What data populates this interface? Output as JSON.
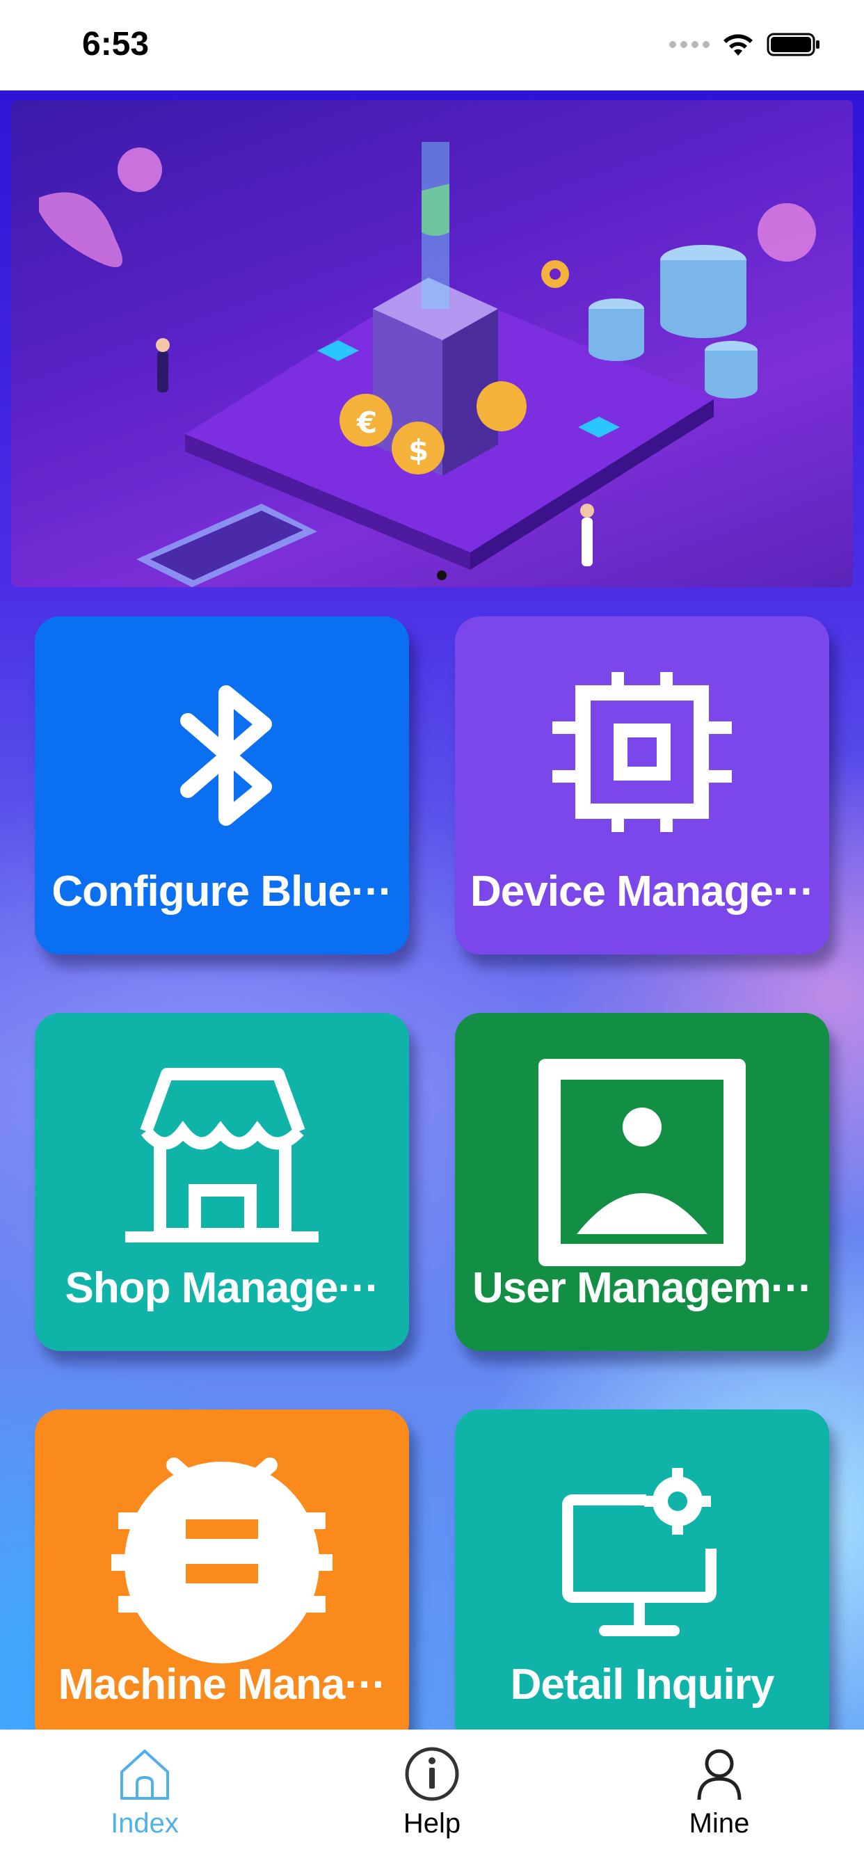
{
  "status_bar": {
    "time": "6:53"
  },
  "banner": {
    "image": "isometric-fintech-illustration",
    "page_indicator": {
      "pages": 1,
      "current": 1
    }
  },
  "tiles": [
    {
      "label": "Configure Blue···",
      "icon": "bluetooth-icon",
      "color": "#0a6ff0"
    },
    {
      "label": "Device Manage···",
      "icon": "chip-icon",
      "color": "#7b47ea"
    },
    {
      "label": "Shop Manage···",
      "icon": "shop-icon",
      "color": "#10b3a8"
    },
    {
      "label": "User Managem···",
      "icon": "user-portrait-icon",
      "color": "#138f45"
    },
    {
      "label": "Machine Mana···",
      "icon": "bug-icon",
      "color": "#fb8a1c"
    },
    {
      "label": "Detail Inquiry",
      "icon": "monitor-settings-icon",
      "color": "#10b3a8"
    }
  ],
  "tab_bar": {
    "active_color": "#4fb0ea",
    "items": [
      {
        "label": "Index",
        "icon": "home-icon",
        "active": true
      },
      {
        "label": "Help",
        "icon": "info-icon",
        "active": false
      },
      {
        "label": "Mine",
        "icon": "person-icon",
        "active": false
      }
    ]
  }
}
